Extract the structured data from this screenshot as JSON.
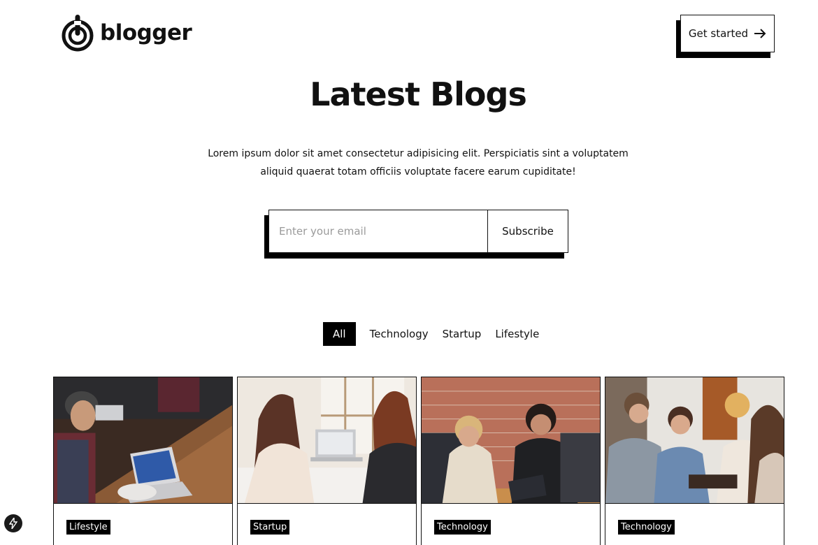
{
  "header": {
    "logo_text": "blogger",
    "cta_label": "Get started"
  },
  "hero": {
    "title": "Latest Blogs",
    "description": "Lorem ipsum dolor sit amet consectetur adipisicing elit. Perspiciatis sint a voluptatem aliquid quaerat totam officiis voluptate facere earum cupiditate!"
  },
  "subscribe": {
    "placeholder": "Enter your email",
    "button_label": "Subscribe"
  },
  "filters": {
    "tabs": [
      {
        "label": "All",
        "active": true
      },
      {
        "label": "Technology",
        "active": false
      },
      {
        "label": "Startup",
        "active": false
      },
      {
        "label": "Lifestyle",
        "active": false
      }
    ]
  },
  "cards": [
    {
      "tag": "Lifestyle"
    },
    {
      "tag": "Startup"
    },
    {
      "tag": "Technology"
    },
    {
      "tag": "Technology"
    }
  ],
  "icons": {
    "logo": "logo-mark-icon",
    "cta_arrow": "arrow-right-icon",
    "floating": "lightning-bolt-icon"
  },
  "colors": {
    "primary": "#000000",
    "background": "#ffffff",
    "placeholder": "#9a9a9a"
  }
}
